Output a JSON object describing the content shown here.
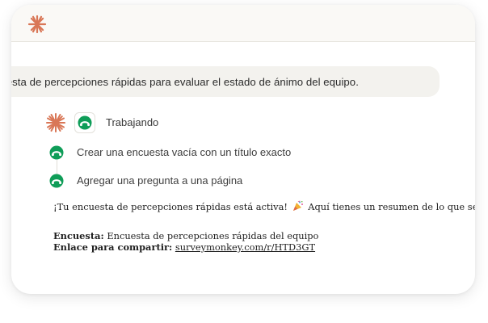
{
  "conversation": {
    "user_message": "a una encuesta de percepciones rápidas para evaluar el estado de ánimo del equipo."
  },
  "assistant": {
    "status_label": "Trabajando",
    "steps": [
      {
        "label": "Crear una encuesta vacía con un título exacto",
        "icon": "surveymonkey-icon"
      },
      {
        "label": "Agregar una pregunta a una página",
        "icon": "surveymonkey-icon"
      }
    ],
    "response": {
      "intro": "¡Tu encuesta de percepciones rápidas está activa!",
      "intro_emoji": "party-popper-icon",
      "intro_rest": "Aquí tienes un resumen de lo que se creó:",
      "survey_label": "Encuesta:",
      "survey_value": "Encuesta de percepciones rápidas del equipo",
      "link_label": "Enlace para compartir:",
      "link_value": "surveymonkey.com/r/HTD3GT"
    }
  },
  "colors": {
    "brand_orange": "#d97757",
    "surveymonkey_green": "#0f9d58",
    "header_bg": "#faf9f6",
    "bubble_bg": "#f3f2ee"
  }
}
